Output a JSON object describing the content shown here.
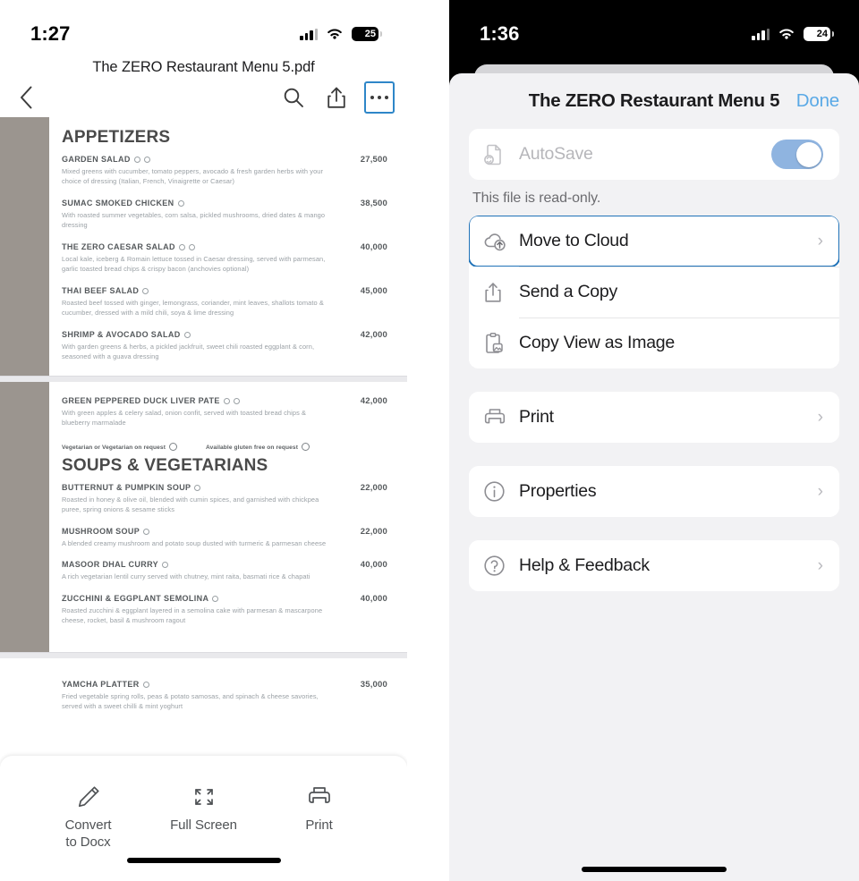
{
  "left_phone": {
    "status_bar": {
      "time": "1:27",
      "battery_level": "25",
      "signal_icon": "cellular-bars-icon",
      "wifi_icon": "wifi-icon",
      "battery_icon": "battery-icon"
    },
    "document_title": "The ZERO Restaurant Menu 5.pdf",
    "nav": {
      "back_icon": "chevron-left-icon",
      "search_icon": "search-icon",
      "share_icon": "share-icon",
      "more_icon": "more-options-icon",
      "more_highlight_color": "#2e86c8"
    },
    "toolbar": [
      {
        "label": "Convert\nto Docx",
        "label_line1": "Convert",
        "label_line2": "to Docx",
        "icon": "pencil-icon"
      },
      {
        "label": "Full Screen",
        "label_line1": "Full Screen",
        "label_line2": "",
        "icon": "full-screen-icon"
      },
      {
        "label": "Print",
        "label_line1": "Print",
        "label_line2": "",
        "icon": "printer-icon"
      }
    ]
  },
  "pdf": {
    "pages": [
      {
        "section_title": "APPETIZERS",
        "items": [
          {
            "name": "GARDEN SALAD",
            "diet_icons": 2,
            "price": "27,500",
            "desc": "Mixed greens with cucumber, tomato peppers, avocado & fresh garden herbs with your choice of dressing (Italian, French, Vinaigrette or Caesar)"
          },
          {
            "name": "SUMAC SMOKED CHICKEN",
            "diet_icons": 1,
            "price": "38,500",
            "desc": "With roasted summer vegetables, corn salsa, pickled mushrooms, dried dates & mango dressing"
          },
          {
            "name": "THE ZERO CAESAR SALAD",
            "diet_icons": 2,
            "price": "40,000",
            "desc": "Local kale, iceberg & Romain lettuce tossed in Caesar dressing, served with parmesan, garlic toasted bread chips & crispy bacon (anchovies optional)"
          },
          {
            "name": "THAI BEEF SALAD",
            "diet_icons": 1,
            "price": "45,000",
            "desc": "Roasted beef tossed with ginger, lemongrass, coriander, mint leaves, shallots tomato & cucumber, dressed with a mild chili, soya & lime dressing"
          },
          {
            "name": "SHRIMP & AVOCADO SALAD",
            "diet_icons": 1,
            "price": "42,000",
            "desc": "With garden greens & herbs, a pickled jackfruit, sweet chili roasted eggplant & corn, seasoned with a guava dressing"
          }
        ]
      },
      {
        "section_title": "SOUPS & VEGETARIANS",
        "pre_items": [
          {
            "name": "GREEN PEPPERED DUCK LIVER PATE",
            "diet_icons": 2,
            "price": "42,000",
            "desc": "With green apples & celery salad, onion confit, served with toasted bread chips & blueberry marmalade"
          }
        ],
        "legend": [
          {
            "text": "Vegetarian or Vegetarian on request",
            "icon": "vegetarian-icon"
          },
          {
            "text": "Available gluten free on request",
            "icon": "gluten-free-icon"
          }
        ],
        "items": [
          {
            "name": "BUTTERNUT & PUMPKIN SOUP",
            "diet_icons": 1,
            "price": "22,000",
            "desc": "Roasted in honey & olive oil, blended with cumin spices, and garnished with chickpea puree, spring onions & sesame sticks"
          },
          {
            "name": "MUSHROOM SOUP",
            "diet_icons": 1,
            "price": "22,000",
            "desc": "A blended creamy mushroom and potato soup dusted with turmeric & parmesan cheese"
          },
          {
            "name": "MASOOR DHAL CURRY",
            "diet_icons": 1,
            "price": "40,000",
            "desc": "A rich vegetarian lentil curry served with chutney, mint raita, basmati rice & chapati"
          },
          {
            "name": "ZUCCHINI & EGGPLANT SEMOLINA",
            "diet_icons": 1,
            "price": "40,000",
            "desc": "Roasted zucchini & eggplant layered in a semolina cake with parmesan & mascarpone cheese, rocket, basil & mushroom ragout"
          }
        ]
      },
      {
        "section_title": "",
        "items": [
          {
            "name": "YAMCHA PLATTER",
            "diet_icons": 1,
            "price": "35,000",
            "desc": "Fried vegetable spring rolls, peas & potato samosas, and spinach & cheese savories, served with a sweet chilli & mint yoghurt"
          }
        ]
      }
    ]
  },
  "right_phone": {
    "status_bar": {
      "time": "1:36",
      "battery_level": "24",
      "signal_icon": "cellular-bars-icon",
      "wifi_icon": "wifi-icon",
      "battery_icon": "battery-icon"
    },
    "sheet": {
      "title": "The ZERO Restaurant Menu 5",
      "done_label": "Done",
      "autosave": {
        "label": "AutoSave",
        "icon": "autosave-document-icon",
        "enabled": true,
        "toggle_color": "#8fb4e0"
      },
      "note": "This file is read-only.",
      "groups": [
        {
          "rows": [
            {
              "label": "Move to Cloud",
              "icon": "cloud-upload-icon",
              "chevron": "›",
              "highlighted": true,
              "highlight_color": "#1f72b8"
            },
            {
              "label": "Send a Copy",
              "icon": "share-icon",
              "chevron": "",
              "highlighted": false
            },
            {
              "label": "Copy View as Image",
              "icon": "clipboard-image-icon",
              "chevron": "",
              "highlighted": false
            }
          ]
        },
        {
          "rows": [
            {
              "label": "Print",
              "icon": "printer-icon",
              "chevron": "›",
              "highlighted": false
            }
          ]
        },
        {
          "rows": [
            {
              "label": "Properties",
              "icon": "info-circle-icon",
              "chevron": "›",
              "highlighted": false
            }
          ]
        },
        {
          "rows": [
            {
              "label": "Help & Feedback",
              "icon": "question-circle-icon",
              "chevron": "›",
              "highlighted": false
            }
          ]
        }
      ]
    }
  }
}
